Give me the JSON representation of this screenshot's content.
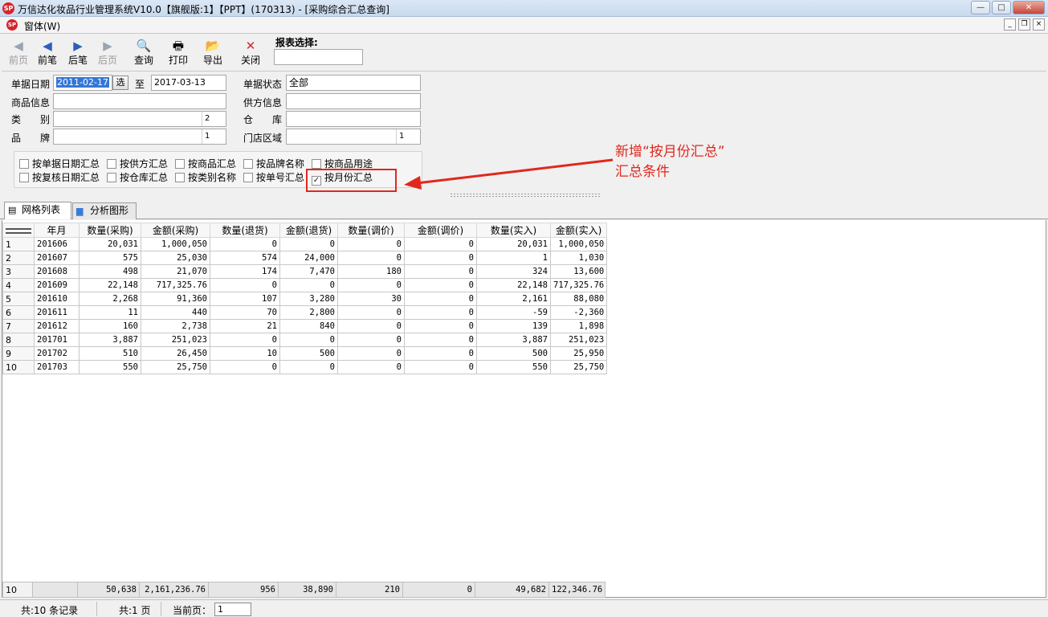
{
  "window": {
    "title": "万信达化妆品行业管理系统V10.0【旗舰版:1】【PPT】(170313) - [采购综合汇总查询]",
    "logo_text": "SP",
    "controls": [
      "—",
      "□",
      "✕"
    ]
  },
  "menu": {
    "item": "窗体(W)",
    "mdi_controls": [
      "_",
      "❐",
      "×"
    ]
  },
  "toolbar": {
    "buttons": [
      {
        "label": "前页",
        "icon": "first-page-icon",
        "glyph": "◀",
        "enabled": false
      },
      {
        "label": "前笔",
        "icon": "prev-record-icon",
        "glyph": "◀",
        "enabled": true
      },
      {
        "label": "后笔",
        "icon": "next-record-icon",
        "glyph": "▶",
        "enabled": true
      },
      {
        "label": "后页",
        "icon": "last-page-icon",
        "glyph": "▶",
        "enabled": false
      },
      {
        "label": "查询",
        "icon": "query-icon",
        "glyph": "🔍",
        "enabled": true
      },
      {
        "label": "打印",
        "icon": "print-icon",
        "glyph": "🖶",
        "enabled": true
      },
      {
        "label": "导出",
        "icon": "export-icon",
        "glyph": "📂",
        "enabled": true
      },
      {
        "label": "关闭",
        "icon": "close-icon",
        "glyph": "✕",
        "enabled": true
      }
    ],
    "report_select_label": "报表选择:",
    "report_select_value": ""
  },
  "filters": {
    "date_label": "单据日期",
    "date_from": "2011-02-17",
    "pick_button": "选",
    "to_label": "至",
    "date_to": "2017-03-13",
    "status_label": "单据状态",
    "status_value": "全部",
    "product_label": "商品信息",
    "product_value": "",
    "supplier_label": "供方信息",
    "supplier_value": "",
    "category_label": "类　　别",
    "category_value": "",
    "category_level": "2",
    "warehouse_label": "仓　　库",
    "warehouse_value": "",
    "brand_label": "品　　牌",
    "brand_value": "",
    "brand_level": "1",
    "region_label": "门店区域",
    "region_value": "",
    "region_level": "1"
  },
  "group_options": [
    {
      "label": "按单据日期汇总",
      "checked": false
    },
    {
      "label": "按供方汇总",
      "checked": false
    },
    {
      "label": "按商品汇总",
      "checked": false
    },
    {
      "label": "按品牌名称",
      "checked": false
    },
    {
      "label": "按商品用途",
      "checked": false
    },
    {
      "label": "按复核日期汇总",
      "checked": false
    },
    {
      "label": "按仓库汇总",
      "checked": false
    },
    {
      "label": "按类别名称",
      "checked": false
    },
    {
      "label": "按单号汇总",
      "checked": false
    },
    {
      "label": "按月份汇总",
      "checked": true
    }
  ],
  "annotation": {
    "line1": "新增“按月份汇总”",
    "line2": "汇总条件",
    "color": "#e0281d"
  },
  "tabs": [
    {
      "label": "网格列表",
      "icon": "grid-list-icon",
      "active": true
    },
    {
      "label": "分析图形",
      "icon": "bar-chart-icon",
      "active": false
    }
  ],
  "table": {
    "columns": [
      "年月",
      "数量(采购)",
      "金额(采购)",
      "数量(退货)",
      "金额(退货)",
      "数量(调价)",
      "金额(调价)",
      "数量(实入)",
      "金额(实入)"
    ],
    "rows": [
      [
        "1",
        "201606",
        "20,031",
        "1,000,050",
        "0",
        "0",
        "0",
        "0",
        "20,031",
        "1,000,050"
      ],
      [
        "2",
        "201607",
        "575",
        "25,030",
        "574",
        "24,000",
        "0",
        "0",
        "1",
        "1,030"
      ],
      [
        "3",
        "201608",
        "498",
        "21,070",
        "174",
        "7,470",
        "180",
        "0",
        "324",
        "13,600"
      ],
      [
        "4",
        "201609",
        "22,148",
        "717,325.76",
        "0",
        "0",
        "0",
        "0",
        "22,148",
        "717,325.76"
      ],
      [
        "5",
        "201610",
        "2,268",
        "91,360",
        "107",
        "3,280",
        "30",
        "0",
        "2,161",
        "88,080"
      ],
      [
        "6",
        "201611",
        "11",
        "440",
        "70",
        "2,800",
        "0",
        "0",
        "-59",
        "-2,360"
      ],
      [
        "7",
        "201612",
        "160",
        "2,738",
        "21",
        "840",
        "0",
        "0",
        "139",
        "1,898"
      ],
      [
        "8",
        "201701",
        "3,887",
        "251,023",
        "0",
        "0",
        "0",
        "0",
        "3,887",
        "251,023"
      ],
      [
        "9",
        "201702",
        "510",
        "26,450",
        "10",
        "500",
        "0",
        "0",
        "500",
        "25,950"
      ],
      [
        "10",
        "201703",
        "550",
        "25,750",
        "0",
        "0",
        "0",
        "0",
        "550",
        "25,750"
      ]
    ],
    "totals": [
      "10",
      "",
      "50,638",
      "2,161,236.76",
      "956",
      "38,890",
      "210",
      "0",
      "49,682",
      "122,346.76"
    ]
  },
  "status": {
    "records": "共:10 条记录",
    "pages": "共:1 页",
    "current_page_label": "当前页：",
    "current_page": "1"
  }
}
